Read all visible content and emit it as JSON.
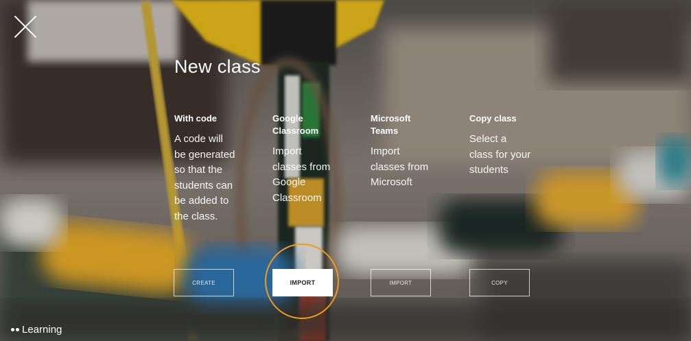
{
  "modal": {
    "title": "New class",
    "close_icon": "close-icon"
  },
  "options": [
    {
      "heading": "With code",
      "description": "A code will be generated so that the students can be added to the class.",
      "button": "CREATE"
    },
    {
      "heading": "Google Classroom",
      "description": "Import classes from Google Classroom",
      "button": "IMPORT"
    },
    {
      "heading": "Microsoft Teams",
      "description": "Import classes from Microsoft",
      "button": "IMPORT"
    },
    {
      "heading": "Copy class",
      "description": "Select a class for your students",
      "button": "COPY"
    }
  ],
  "footer": {
    "brand": "Learning"
  },
  "colors": {
    "highlight_ring": "#f39a1c",
    "primary_button_bg": "#ffffff",
    "text": "#ffffff"
  }
}
